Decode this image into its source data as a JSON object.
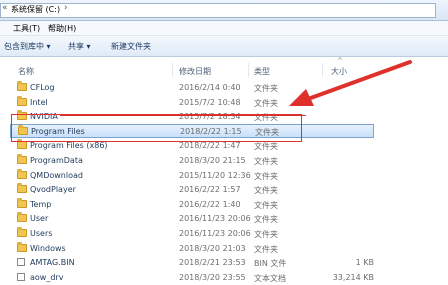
{
  "address": {
    "segments": [
      "系统保留 (C:)"
    ]
  },
  "menu": {
    "items": [
      "工具(T)",
      "帮助(H)"
    ]
  },
  "toolbar": {
    "include": "包含到库中 ▾",
    "share": "共享 ▾",
    "new_folder": "新建文件夹"
  },
  "columns": {
    "name": "名称",
    "date": "修改日期",
    "type": "类型",
    "size": "大小"
  },
  "files": [
    {
      "name": "CFLog",
      "date": "2016/2/14 0:40",
      "type": "文件夹",
      "size": "",
      "kind": "folder"
    },
    {
      "name": "Intel",
      "date": "2015/7/2 10:48",
      "type": "文件夹",
      "size": "",
      "kind": "folder"
    },
    {
      "name": "NVIDIA",
      "date": "2015/7/2 18:34",
      "type": "文件夹",
      "size": "",
      "kind": "folder"
    },
    {
      "name": "Program Files",
      "date": "2018/2/22 1:15",
      "type": "文件夹",
      "size": "",
      "kind": "folder",
      "selected": true
    },
    {
      "name": "Program Files (x86)",
      "date": "2018/2/22 1:47",
      "type": "文件夹",
      "size": "",
      "kind": "folder"
    },
    {
      "name": "ProgramData",
      "date": "2018/3/20 21:15",
      "type": "文件夹",
      "size": "",
      "kind": "folder"
    },
    {
      "name": "QMDownload",
      "date": "2015/11/20 12:36",
      "type": "文件夹",
      "size": "",
      "kind": "folder"
    },
    {
      "name": "QvodPlayer",
      "date": "2016/2/22 1:57",
      "type": "文件夹",
      "size": "",
      "kind": "folder"
    },
    {
      "name": "Temp",
      "date": "2016/2/22 1:40",
      "type": "文件夹",
      "size": "",
      "kind": "folder"
    },
    {
      "name": "User",
      "date": "2016/11/23 20:06",
      "type": "文件夹",
      "size": "",
      "kind": "folder"
    },
    {
      "name": "Users",
      "date": "2016/11/23 20:06",
      "type": "文件夹",
      "size": "",
      "kind": "folder"
    },
    {
      "name": "Windows",
      "date": "2018/3/20 21:03",
      "type": "文件夹",
      "size": "",
      "kind": "folder"
    },
    {
      "name": "AMTAG.BIN",
      "date": "2018/2/21 23:53",
      "type": "BIN 文件",
      "size": "1 KB",
      "kind": "file"
    },
    {
      "name": "aow_drv",
      "date": "2018/3/20 23:55",
      "type": "文本文档",
      "size": "33,214 KB",
      "kind": "file"
    }
  ],
  "colors": {
    "highlight": "#e0302c",
    "selection": "#c9e0fa",
    "folder": "#f2c550"
  }
}
